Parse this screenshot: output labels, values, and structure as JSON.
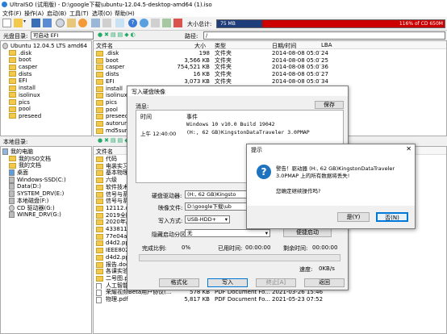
{
  "window": {
    "title": "UltraISO (试用版) - D:\\google下载\\ubuntu-12.04.5-desktop-amd64 (1).iso"
  },
  "menu": [
    "文件(F)",
    "操作(A)",
    "启动(B)",
    "工具(T)",
    "选项(O)",
    "帮助(H)"
  ],
  "toolbar": {
    "size_label": "大小总计:",
    "size_value": "75 MB",
    "usage_text": "116% of CD 650M"
  },
  "image_bar": {
    "label": "光盘目录:",
    "volume": "可启动 EFI",
    "path_label": "路径:",
    "path_value": "/"
  },
  "iso_tree": [
    "Ubuntu 12.04.5 LTS amd64",
    ".disk",
    "boot",
    "casper",
    "dists",
    "EFI",
    "install",
    "isolinux",
    "pics",
    "pool",
    "preseed"
  ],
  "iso_list": {
    "headers": [
      "文件名",
      "大小",
      "类型",
      "日期/时间",
      "LBA"
    ],
    "rows": [
      {
        "name": ".disk",
        "size": "198",
        "type": "文件夹",
        "date": "2014-08-08 05:07",
        "lba": "24"
      },
      {
        "name": "boot",
        "size": "3,566 KB",
        "type": "文件夹",
        "date": "2014-08-08 05:07",
        "lba": "25"
      },
      {
        "name": "casper",
        "size": "754,521 KB",
        "type": "文件夹",
        "date": "2014-08-08 05:07",
        "lba": "36"
      },
      {
        "name": "dists",
        "size": "16 KB",
        "type": "文件夹",
        "date": "2014-08-08 05:07",
        "lba": "27"
      },
      {
        "name": "EFI",
        "size": "3,073 KB",
        "type": "文件夹",
        "date": "2014-08-08 05:07",
        "lba": "34"
      },
      {
        "name": "install",
        "size": "",
        "type": "",
        "date": "",
        "lba": ""
      },
      {
        "name": "isolinux",
        "size": "",
        "type": "",
        "date": "",
        "lba": ""
      },
      {
        "name": "pics",
        "size": "",
        "type": "",
        "date": "",
        "lba": ""
      },
      {
        "name": "pool",
        "size": "",
        "type": "",
        "date": "",
        "lba": ""
      },
      {
        "name": "preseed",
        "size": "",
        "type": "",
        "date": "",
        "lba": ""
      },
      {
        "name": "autorun.in",
        "size": "",
        "type": "",
        "date": "",
        "lba": ""
      },
      {
        "name": "md5sum.txt",
        "size": "",
        "type": "",
        "date": "",
        "lba": ""
      }
    ]
  },
  "local": {
    "label": "本地目录:",
    "tree": [
      "我的电脑",
      "我的ISO文档",
      "我的文档",
      "桌面",
      "Windows-SSD(C:)",
      "Data(D:)",
      "SYSTEM_DRV(E:)",
      "本地磁盘(F:)",
      "CD 驱动器(G:)",
      "WINRE_DRV(G:)"
    ],
    "headers": [
      "文件名"
    ],
    "rows": [
      {
        "name": "代码",
        "size": "",
        "type": "",
        "date": ""
      },
      {
        "name": "电装实习",
        "size": "",
        "type": "",
        "date": ""
      },
      {
        "name": "基本物理",
        "size": "",
        "type": "",
        "date": ""
      },
      {
        "name": "六级",
        "size": "",
        "type": "",
        "date": ""
      },
      {
        "name": "软件技术基础",
        "size": "",
        "type": "",
        "date": ""
      },
      {
        "name": "信号与系统",
        "size": "",
        "type": "",
        "date": ""
      },
      {
        "name": "信号与系统",
        "size": "",
        "type": "",
        "date": ""
      },
      {
        "name": "12112.docx",
        "size": "",
        "type": "",
        "date": ""
      },
      {
        "name": "2019全国大学",
        "size": "",
        "type": "",
        "date": ""
      },
      {
        "name": "2020年高考",
        "size": "",
        "type": "",
        "date": ""
      },
      {
        "name": "4338118_金融",
        "size": "",
        "type": "",
        "date": ""
      },
      {
        "name": "77e04ab3b",
        "size": "",
        "type": "",
        "date": ""
      },
      {
        "name": "d4d2.pptx",
        "size": "",
        "type": "",
        "date": ""
      },
      {
        "name": "IEEE802 11",
        "size": "",
        "type": "",
        "date": ""
      },
      {
        "name": "d4d2.pptx",
        "size": "",
        "type": "",
        "date": ""
      },
      {
        "name": "报告.doc",
        "size": "",
        "type": "",
        "date": ""
      },
      {
        "name": "各课实验",
        "size": "",
        "type": "",
        "date": ""
      },
      {
        "name": "二号图.pdf",
        "size": "",
        "type": "",
        "date": ""
      },
      {
        "name": "人工智能基础.docx",
        "size": "16 KB",
        "type": "Microsoft Word...",
        "date": "2021-03-30 12:39"
      },
      {
        "name": "荣耀视频Beta用户协议(...",
        "size": "578 KB",
        "type": "PDF Document Fo...",
        "date": "2021-03-26 15:46"
      },
      {
        "name": "物理.pdf",
        "size": "5,817 KB",
        "type": "PDF Document Fo...",
        "date": "2021-05-23 07:52"
      }
    ]
  },
  "write_dialog": {
    "title": "写入硬盘映像",
    "msg_label": "消息:",
    "save_button": "保存",
    "log_headers": [
      "时间",
      "事件"
    ],
    "log": [
      {
        "time": "",
        "event": "Windows 10 v10.0 Build 19042"
      },
      {
        "time": "上午 12:40:00",
        "event": "(H:, 62 GB)KingstonDataTraveler 3.0PMAP"
      }
    ],
    "drive_label": "硬盘驱动器:",
    "drive_value": "(H:, 62 GB)Kingsto",
    "image_label": "映像文件:",
    "image_value": "D:\\google下载\\ub",
    "method_label": "写入方式:",
    "method_value": "USB-HDD+",
    "hide_label": "隐藏启动分区:",
    "hide_value": "无",
    "bootstrap_button": "便捷启动",
    "done_label": "完成比例:",
    "done_value": "0%",
    "elapsed_label": "已用时间:",
    "elapsed_value": "00:00:00",
    "remain_label": "剩余时间:",
    "remain_value": "00:00:00",
    "speed_label": "速度:",
    "speed_value": "0KB/s",
    "progress": 0,
    "format_button": "格式化",
    "write_button": "写入",
    "stop_button": "终止[A]",
    "back_button": "返回"
  },
  "confirm_dialog": {
    "title": "提示",
    "message": "警告！驱动器 (H:, 62 GB)KingstonDataTraveler 3.0PMAP 上的所有数据将丢失!",
    "question": "您确定继续操作吗?",
    "yes_button": "是(Y)",
    "no_button": "否(N)"
  }
}
